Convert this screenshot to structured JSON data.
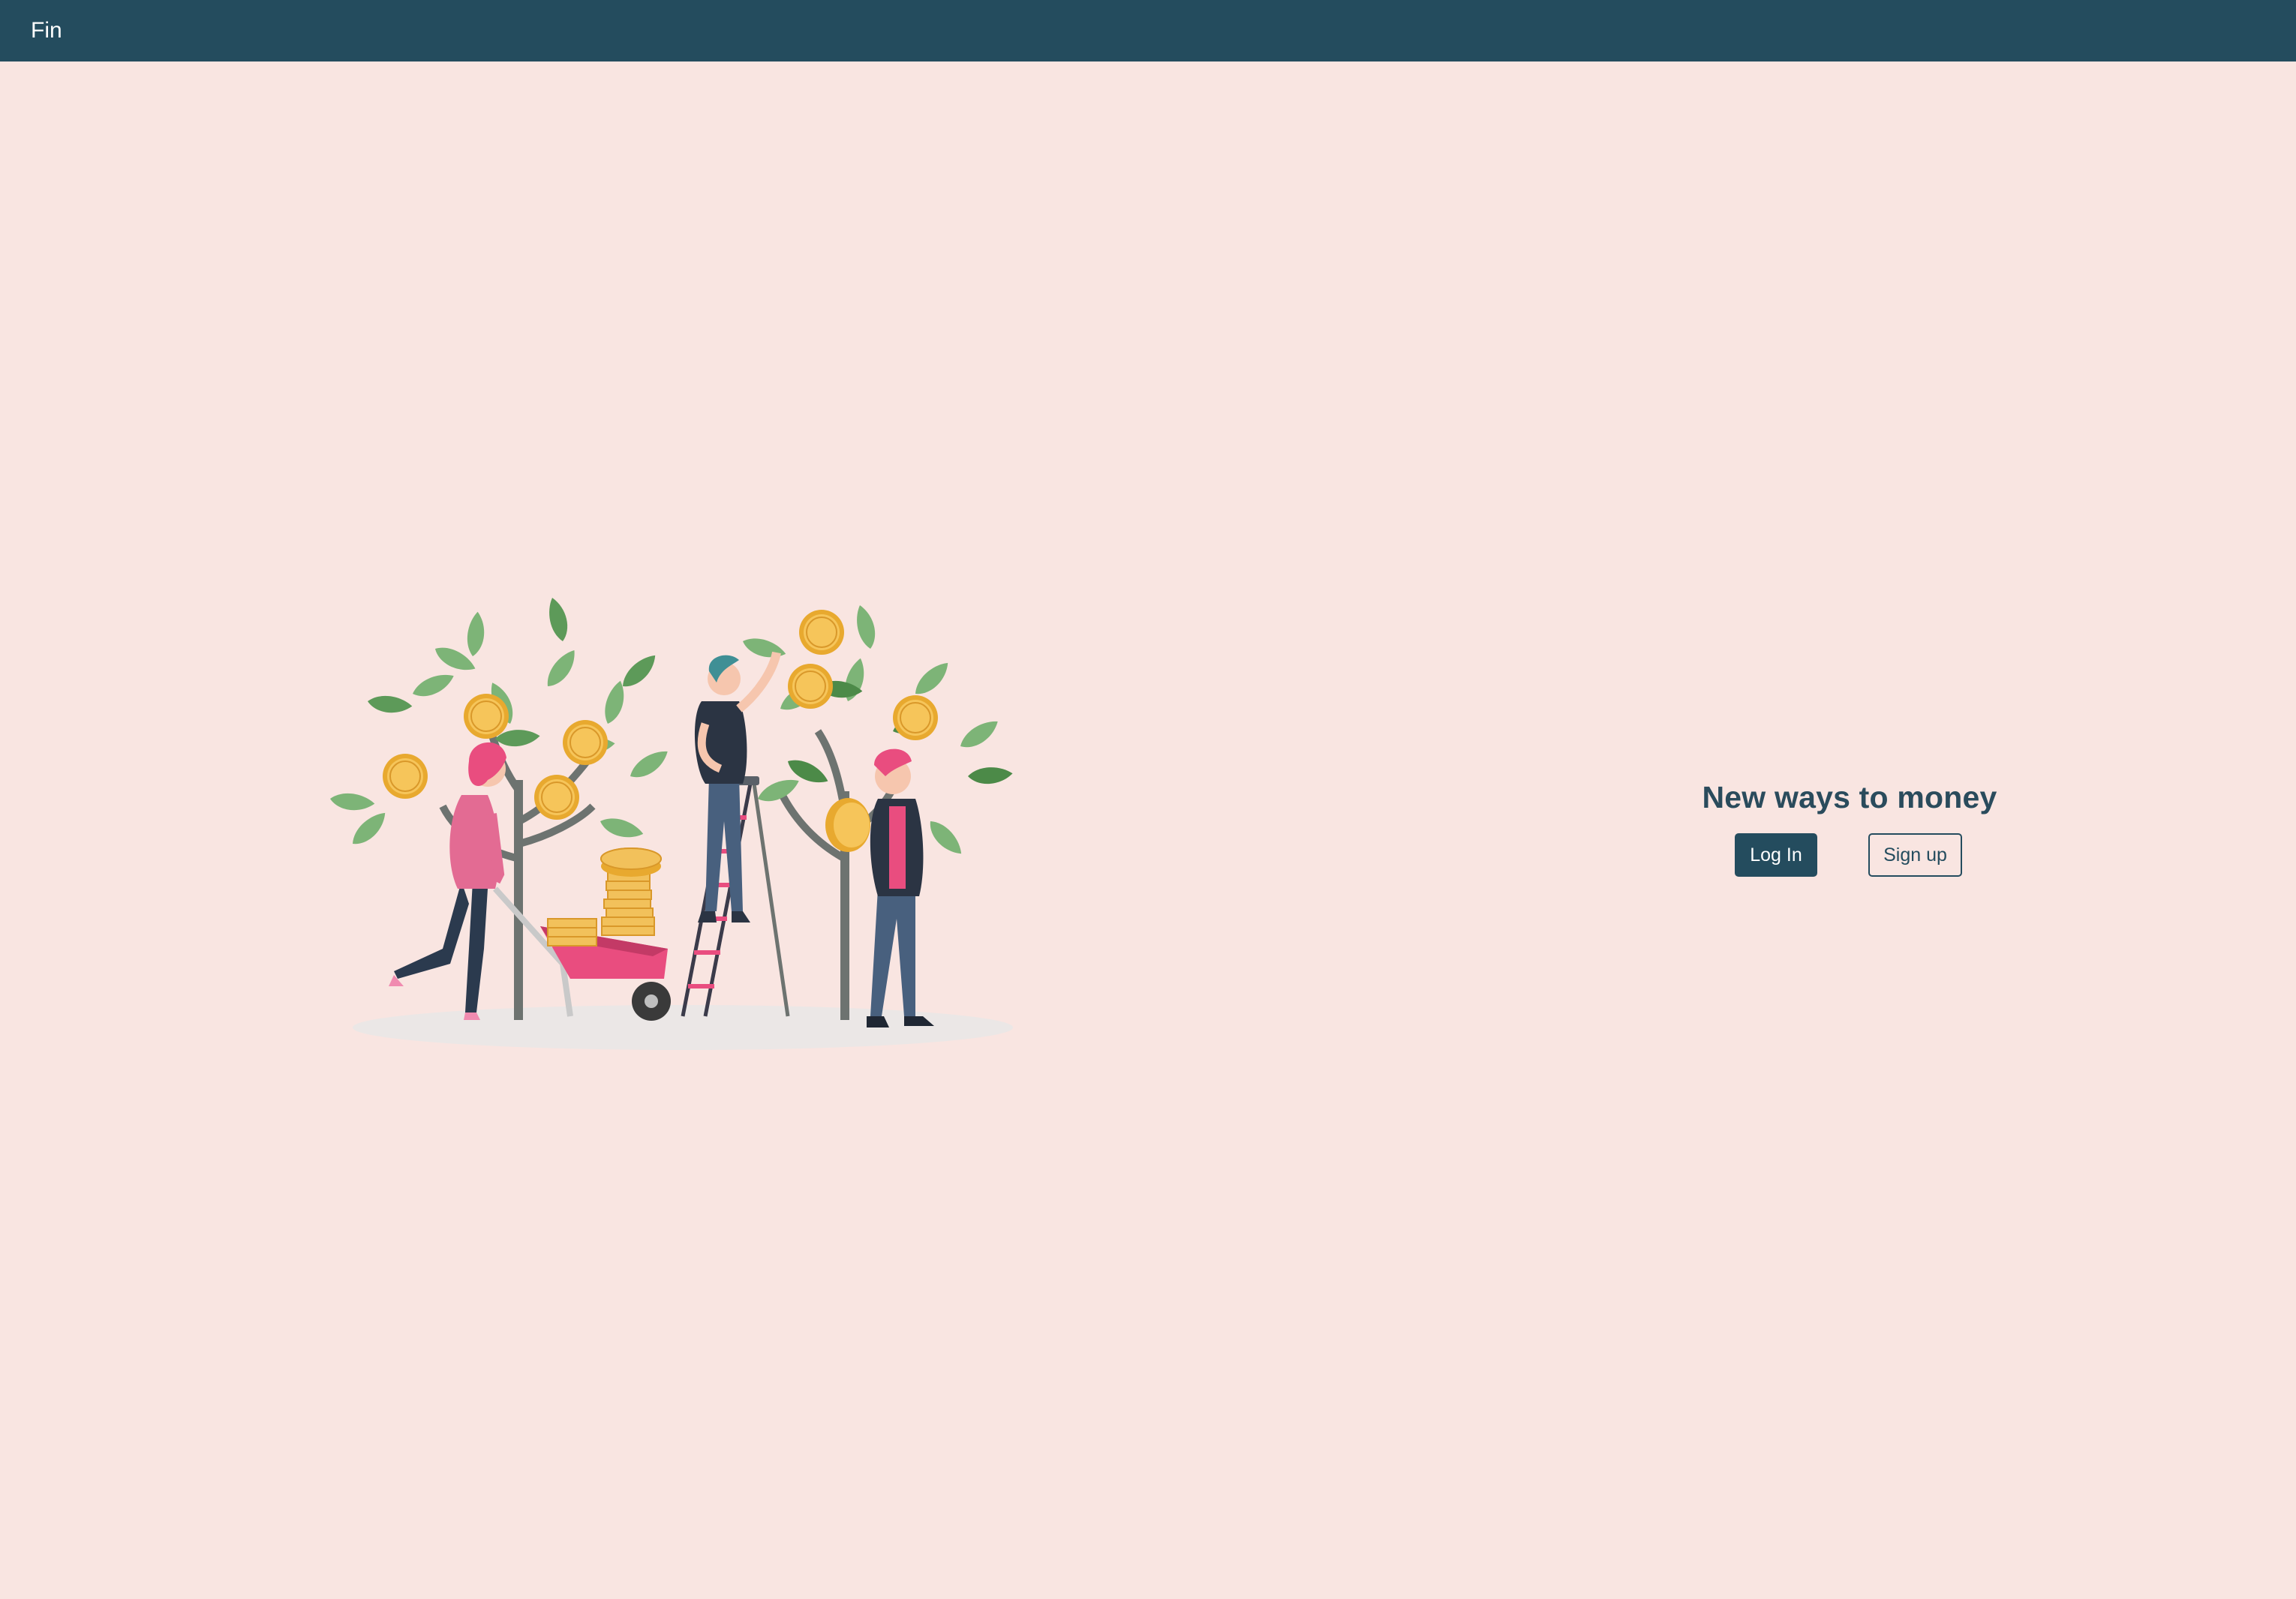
{
  "navbar": {
    "brand": "Fin",
    "background_color": "#244c5e"
  },
  "hero": {
    "illustration_icon": "money-tree-harvest-illustration",
    "headline": "New ways to money",
    "login_label": "Log In",
    "signup_label": "Sign up"
  },
  "colors": {
    "page_background": "#f9e5e1",
    "accent": "#244c5e",
    "coin": "#f2b84b",
    "leaf": "#6fae6b",
    "pink": "#e94d7f"
  }
}
